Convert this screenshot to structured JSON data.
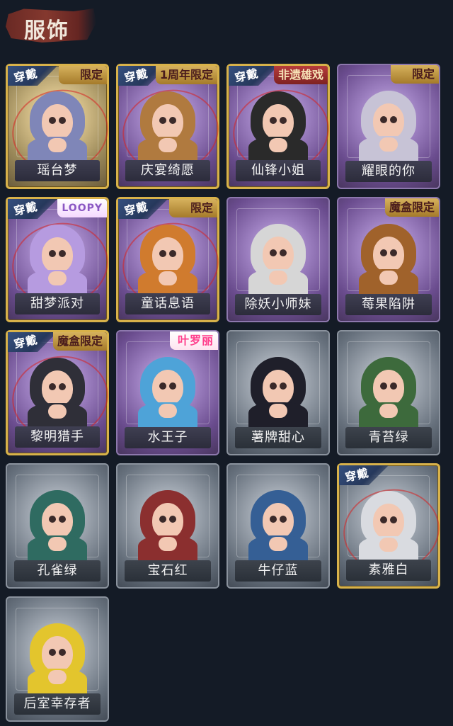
{
  "header": {
    "title": "服饰"
  },
  "cards": [
    {
      "name": "瑶台梦",
      "wear_label": "穿戴",
      "limited_label": "限定",
      "skin": "gold",
      "equipped": true,
      "theme_color": "#7f86b8"
    },
    {
      "name": "庆宴绮愿",
      "wear_label": "穿戴",
      "limited_label": "1周年限定",
      "skin": "purple",
      "equipped": true,
      "theme_color": "#b07a3f"
    },
    {
      "name": "仙锋小姐",
      "wear_label": "穿戴",
      "limited_label": "非遗雄戏",
      "skin": "purple",
      "equipped": true,
      "theme_color": "#2a2a2a"
    },
    {
      "name": "耀眼的你",
      "wear_label": "",
      "limited_label": "限定",
      "skin": "purple",
      "equipped": false,
      "theme_color": "#c7c3d6"
    },
    {
      "name": "甜梦派对",
      "wear_label": "穿戴",
      "limited_label": "LOOPY",
      "skin": "purple",
      "equipped": true,
      "theme_color": "#b69be0"
    },
    {
      "name": "童话息语",
      "wear_label": "穿戴",
      "limited_label": "限定",
      "skin": "purple",
      "equipped": true,
      "theme_color": "#d07b2e"
    },
    {
      "name": "除妖小师妹",
      "wear_label": "",
      "limited_label": "",
      "skin": "purple",
      "equipped": false,
      "theme_color": "#d6d6d6"
    },
    {
      "name": "莓果陷阱",
      "wear_label": "",
      "limited_label": "魔盒限定",
      "skin": "purple",
      "equipped": false,
      "theme_color": "#a0622b"
    },
    {
      "name": "黎明猎手",
      "wear_label": "穿戴",
      "limited_label": "魔盒限定",
      "skin": "purple",
      "equipped": true,
      "theme_color": "#2f2f38"
    },
    {
      "name": "水王子",
      "wear_label": "",
      "limited_label": "叶罗丽",
      "skin": "purple",
      "equipped": false,
      "theme_color": "#4ea3d8"
    },
    {
      "name": "薯牌甜心",
      "wear_label": "",
      "limited_label": "",
      "skin": "gray",
      "equipped": false,
      "theme_color": "#1f1f2a"
    },
    {
      "name": "青苔绿",
      "wear_label": "",
      "limited_label": "",
      "skin": "gray",
      "equipped": false,
      "theme_color": "#3d6a3c"
    },
    {
      "name": "孔雀绿",
      "wear_label": "",
      "limited_label": "",
      "skin": "gray",
      "equipped": false,
      "theme_color": "#2f6b61"
    },
    {
      "name": "宝石红",
      "wear_label": "",
      "limited_label": "",
      "skin": "gray",
      "equipped": false,
      "theme_color": "#8b2f2f"
    },
    {
      "name": "牛仔蓝",
      "wear_label": "",
      "limited_label": "",
      "skin": "gray",
      "equipped": false,
      "theme_color": "#355f95"
    },
    {
      "name": "素雅白",
      "wear_label": "穿戴",
      "limited_label": "",
      "skin": "gray",
      "equipped": true,
      "theme_color": "#d9dbe0"
    },
    {
      "name": "后室幸存者",
      "wear_label": "",
      "limited_label": "",
      "skin": "gray",
      "equipped": false,
      "theme_color": "#e3c52d"
    }
  ]
}
